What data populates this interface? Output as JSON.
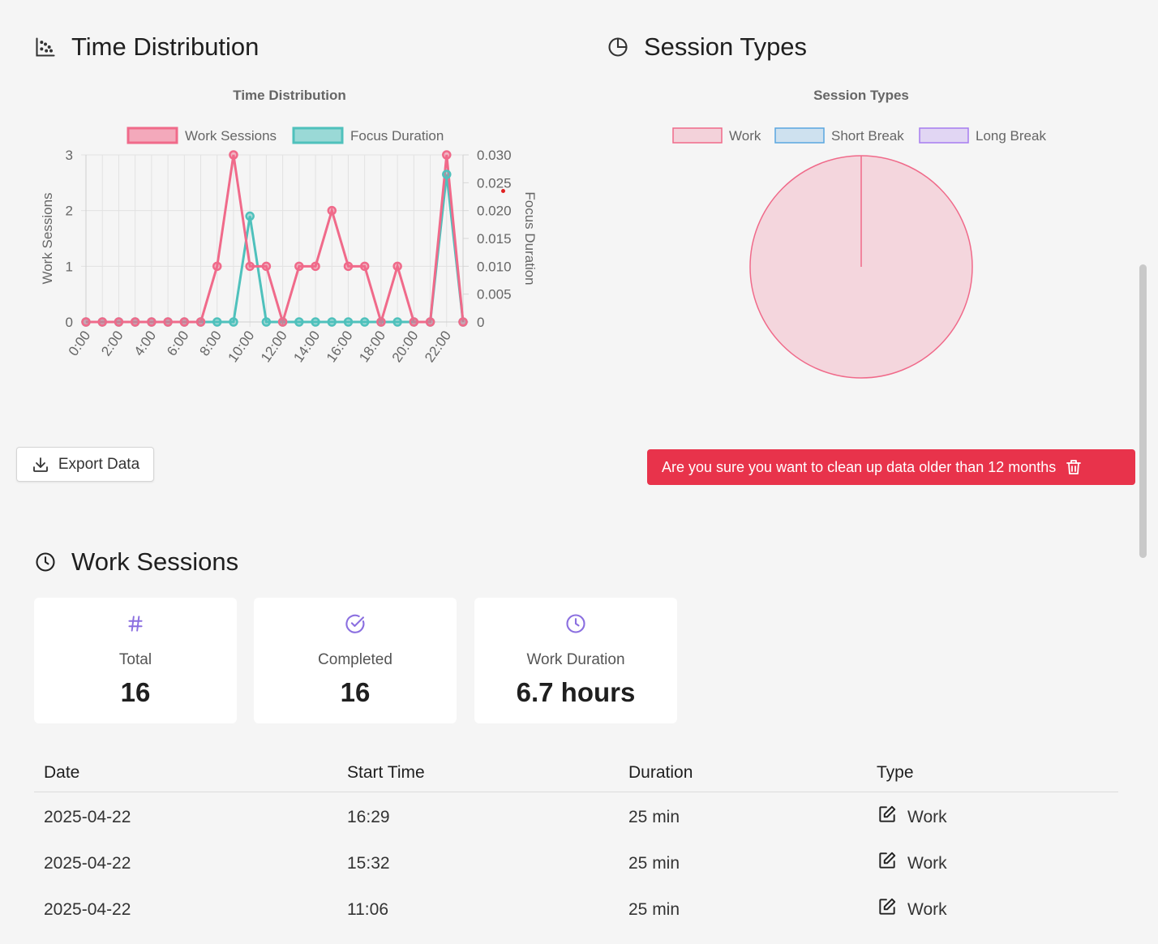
{
  "sections": {
    "time_distribution": "Time Distribution",
    "session_types": "Session Types",
    "work_sessions": "Work Sessions"
  },
  "buttons": {
    "export": "Export Data",
    "cleanup": "Are you sure you want to clean up data older than 12 months"
  },
  "stats": [
    {
      "label": "Total",
      "value": "16",
      "icon": "hash-icon"
    },
    {
      "label": "Completed",
      "value": "16",
      "icon": "check-circle-icon"
    },
    {
      "label": "Work Duration",
      "value": "6.7 hours",
      "icon": "clock-icon"
    }
  ],
  "table": {
    "headers": [
      "Date",
      "Start Time",
      "Duration",
      "Type"
    ],
    "rows": [
      {
        "date": "2025-04-22",
        "start": "16:29",
        "duration": "25 min",
        "type": "Work"
      },
      {
        "date": "2025-04-22",
        "start": "15:32",
        "duration": "25 min",
        "type": "Work"
      },
      {
        "date": "2025-04-22",
        "start": "11:06",
        "duration": "25 min",
        "type": "Work"
      }
    ]
  },
  "colors": {
    "accent_purple": "#8b6fe0",
    "danger": "#e8334b",
    "work_line": "#f06a8a",
    "focus_line": "#4fc1bc"
  },
  "chart_data": [
    {
      "type": "line",
      "title": "Time Distribution",
      "x": [
        "0:00",
        "1:00",
        "2:00",
        "3:00",
        "4:00",
        "5:00",
        "6:00",
        "7:00",
        "8:00",
        "9:00",
        "10:00",
        "11:00",
        "12:00",
        "13:00",
        "14:00",
        "15:00",
        "16:00",
        "17:00",
        "18:00",
        "19:00",
        "20:00",
        "21:00",
        "22:00",
        "23:00"
      ],
      "x_tick_labels": [
        "0:00",
        "2:00",
        "4:00",
        "6:00",
        "8:00",
        "10:00",
        "12:00",
        "14:00",
        "16:00",
        "18:00",
        "20:00",
        "22:00"
      ],
      "series": [
        {
          "name": "Work Sessions",
          "axis": "left",
          "color": "#f06a8a",
          "values": [
            0,
            0,
            0,
            0,
            0,
            0,
            0,
            0,
            1,
            3,
            1,
            1,
            0,
            1,
            1,
            2,
            1,
            1,
            0,
            1,
            0,
            0,
            3,
            0
          ]
        },
        {
          "name": "Focus Duration",
          "axis": "right",
          "color": "#4fc1bc",
          "values": [
            0,
            0,
            0,
            0,
            0,
            0,
            0,
            0,
            0,
            0,
            0.019,
            0,
            0,
            0,
            0,
            0,
            0,
            0,
            0,
            0,
            0,
            0,
            0.0265,
            0
          ]
        }
      ],
      "ylabel": "Work Sessions",
      "ylabel_right": "Focus Duration",
      "ylim": [
        0,
        3
      ],
      "ylim_right": [
        0,
        0.03
      ],
      "y_ticks": [
        "0",
        "1",
        "2",
        "3"
      ],
      "y_ticks_right": [
        "0",
        "0.005",
        "0.010",
        "0.015",
        "0.020",
        "0.025",
        "0.030"
      ],
      "grid": true,
      "legend": "top"
    },
    {
      "type": "pie",
      "title": "Session Types",
      "categories": [
        "Work",
        "Short Break",
        "Long Break"
      ],
      "values": [
        16,
        0,
        0
      ],
      "colors": [
        "#f06a8a",
        "#5aa6e0",
        "#a67cf0"
      ],
      "legend": "top"
    }
  ]
}
